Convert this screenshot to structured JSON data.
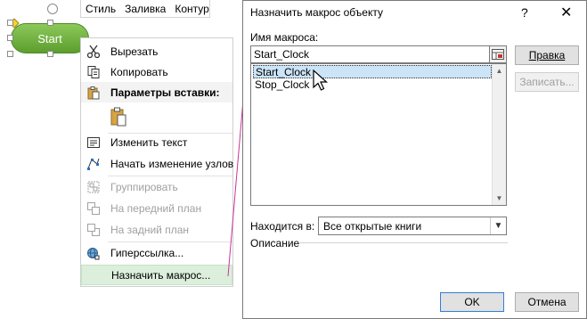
{
  "shape": {
    "label": "Start"
  },
  "mini_toolbar": {
    "items": [
      "Стиль",
      "Заливка",
      "Контур"
    ]
  },
  "context_menu": {
    "items": [
      {
        "label": "Вырезать",
        "icon": "scissors-icon",
        "disabled": false
      },
      {
        "label": "Копировать",
        "icon": "copy-icon",
        "disabled": false
      },
      {
        "label": "Параметры вставки:",
        "icon": "paste-icon",
        "disabled": false,
        "bold": true
      },
      {
        "label": "Изменить текст",
        "icon": "edit-text-icon",
        "disabled": false
      },
      {
        "label": "Начать изменение узлов",
        "icon": "edit-points-icon",
        "disabled": false
      },
      {
        "label": "Группировать",
        "icon": "group-icon",
        "disabled": true
      },
      {
        "label": "На передний план",
        "icon": "bring-forward-icon",
        "disabled": true
      },
      {
        "label": "На задний план",
        "icon": "send-backward-icon",
        "disabled": true
      },
      {
        "label": "Гиперссылка...",
        "icon": "hyperlink-icon",
        "disabled": false
      },
      {
        "label": "Назначить макрос...",
        "icon": "",
        "disabled": false,
        "highlighted": true
      }
    ]
  },
  "dialog": {
    "title": "Назначить макрос объекту",
    "help": "?",
    "close": "✕",
    "macro_name_label": "Имя макроса:",
    "macro_name_value": "Start_Clock",
    "macros": [
      "Start_Clock",
      "Stop_Clock"
    ],
    "selected_macro": "Start_Clock",
    "edit_button": "Правка",
    "record_button": "Записать...",
    "located_in_label": "Находится в:",
    "located_in_value": "Все открытые книги",
    "description_label": "Описание",
    "ok_button": "OK",
    "cancel_button": "Отмена"
  },
  "colors": {
    "shape_fill": "#6aab3a",
    "menu_highlight": "#dcefdc",
    "list_selection": "#cce4f7",
    "leader_line": "#cc3399"
  }
}
